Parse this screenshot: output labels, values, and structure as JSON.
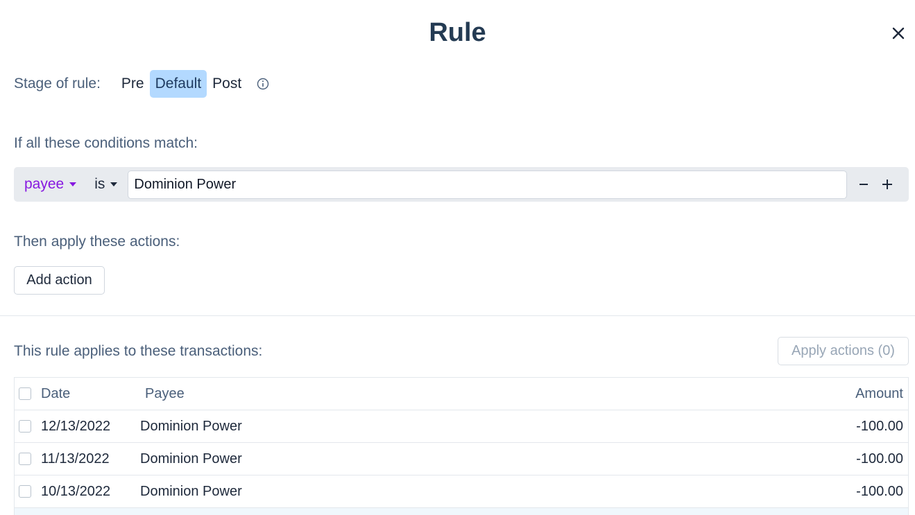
{
  "modal": {
    "title": "Rule",
    "close_icon": "close-icon"
  },
  "stage": {
    "label": "Stage of rule:",
    "options": [
      "Pre",
      "Default",
      "Post"
    ],
    "selected": "Default",
    "info_icon": "info-circle-icon"
  },
  "conditions": {
    "label": "If all these conditions match:",
    "items": [
      {
        "field": "payee",
        "op": "is",
        "value": "Dominion Power"
      }
    ],
    "remove_icon": "minus-icon",
    "add_icon": "plus-icon"
  },
  "actions": {
    "label": "Then apply these actions:",
    "add_label": "Add action"
  },
  "transactions": {
    "label": "This rule applies to these transactions:",
    "apply_label": "Apply actions (0)",
    "columns": {
      "date": "Date",
      "payee": "Payee",
      "amount": "Amount"
    },
    "rows": [
      {
        "date": "12/13/2022",
        "payee": "Dominion Power",
        "amount": "-100.00"
      },
      {
        "date": "11/13/2022",
        "payee": "Dominion Power",
        "amount": "-100.00"
      },
      {
        "date": "10/13/2022",
        "payee": "Dominion Power",
        "amount": "-100.00"
      }
    ]
  },
  "colors": {
    "accent": "#b3d9ff",
    "field_purple": "#8719e0",
    "title": "#243b53",
    "label": "#4a5f7a"
  }
}
